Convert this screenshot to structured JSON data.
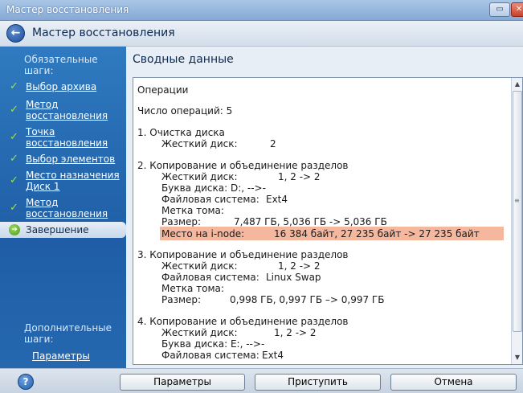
{
  "window": {
    "title": "Мастер восстановления",
    "header_title": "Мастер восстановления"
  },
  "sidebar": {
    "required_heading": "Обязательные шаги:",
    "steps": [
      {
        "label": "Выбор архива",
        "done": true
      },
      {
        "label": "Метод восстановления",
        "done": true
      },
      {
        "label": "Точка восстановления",
        "done": true
      },
      {
        "label": "Выбор элементов",
        "done": true
      },
      {
        "label": "Место назначения Диск 1",
        "done": true
      },
      {
        "label": "Метод восстановления",
        "done": true
      },
      {
        "label": "Завершение",
        "current": true
      }
    ],
    "optional_heading": "Дополнительные шаги:",
    "params_link": "Параметры"
  },
  "main": {
    "section_title": "Сводные данные",
    "summary": {
      "operations_heading": "Операции",
      "op_count": "Число операций: 5",
      "op1": {
        "title": "1. Очистка диска",
        "disk_label": "Жесткий диск:",
        "disk_value": "2"
      },
      "op2": {
        "title": "2. Копирование и объединение разделов",
        "disk_label": "Жесткий диск:",
        "disk_value": "1, 2 -> 2",
        "letter_label": "Буква диска: D:, -->-",
        "fs_label": "Файловая система:",
        "fs_value": "Ext4",
        "volume_label": "Метка тома:",
        "size_label": "Размер:",
        "size_value": "7,487 ГБ, 5,036 ГБ -> 5,036 ГБ",
        "inode_label": "Место на i-node:",
        "inode_value": "16 384 байт, 27 235 байт -> 27 235 байт"
      },
      "op3": {
        "title": "3. Копирование и объединение разделов",
        "disk_label": "Жесткий диск:",
        "disk_value": "1, 2 -> 2",
        "fs_label": "Файловая система:",
        "fs_value": "Linux Swap",
        "volume_label": "Метка тома:",
        "size_label": "Размер:",
        "size_value": "0,998 ГБ, 0,997 ГБ –> 0,997 ГБ"
      },
      "op4": {
        "title": "4. Копирование и объединение разделов",
        "disk_label": "Жесткий диск:",
        "disk_value": "1, 2 -> 2",
        "letter_label": "Буква диска: E:, -->-",
        "fs_label": "Файловая система:",
        "fs_value": "Ext4"
      }
    }
  },
  "buttons": {
    "params": "Параметры",
    "proceed": "Приступить",
    "cancel": "Отмена"
  },
  "colors": {
    "sidebar": "#2568b0",
    "highlight": "#f5b79e",
    "check": "#9fe04a"
  }
}
